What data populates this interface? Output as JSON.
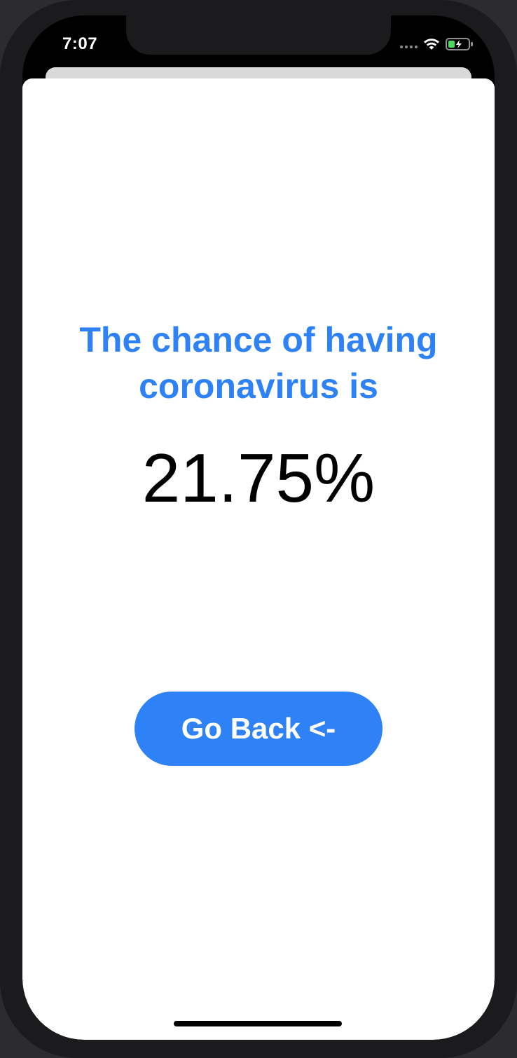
{
  "status_bar": {
    "time": "7:07",
    "icons": [
      "cellular-signal-icon",
      "wifi-icon",
      "battery-charging-icon"
    ]
  },
  "result": {
    "headline_line1": "The chance of having",
    "headline_line2": "coronavirus is",
    "percentage": "21.75%"
  },
  "actions": {
    "go_back_label": "Go Back <-"
  },
  "colors": {
    "accent": "#2f82f6",
    "background": "#ffffff",
    "text": "#000000"
  }
}
